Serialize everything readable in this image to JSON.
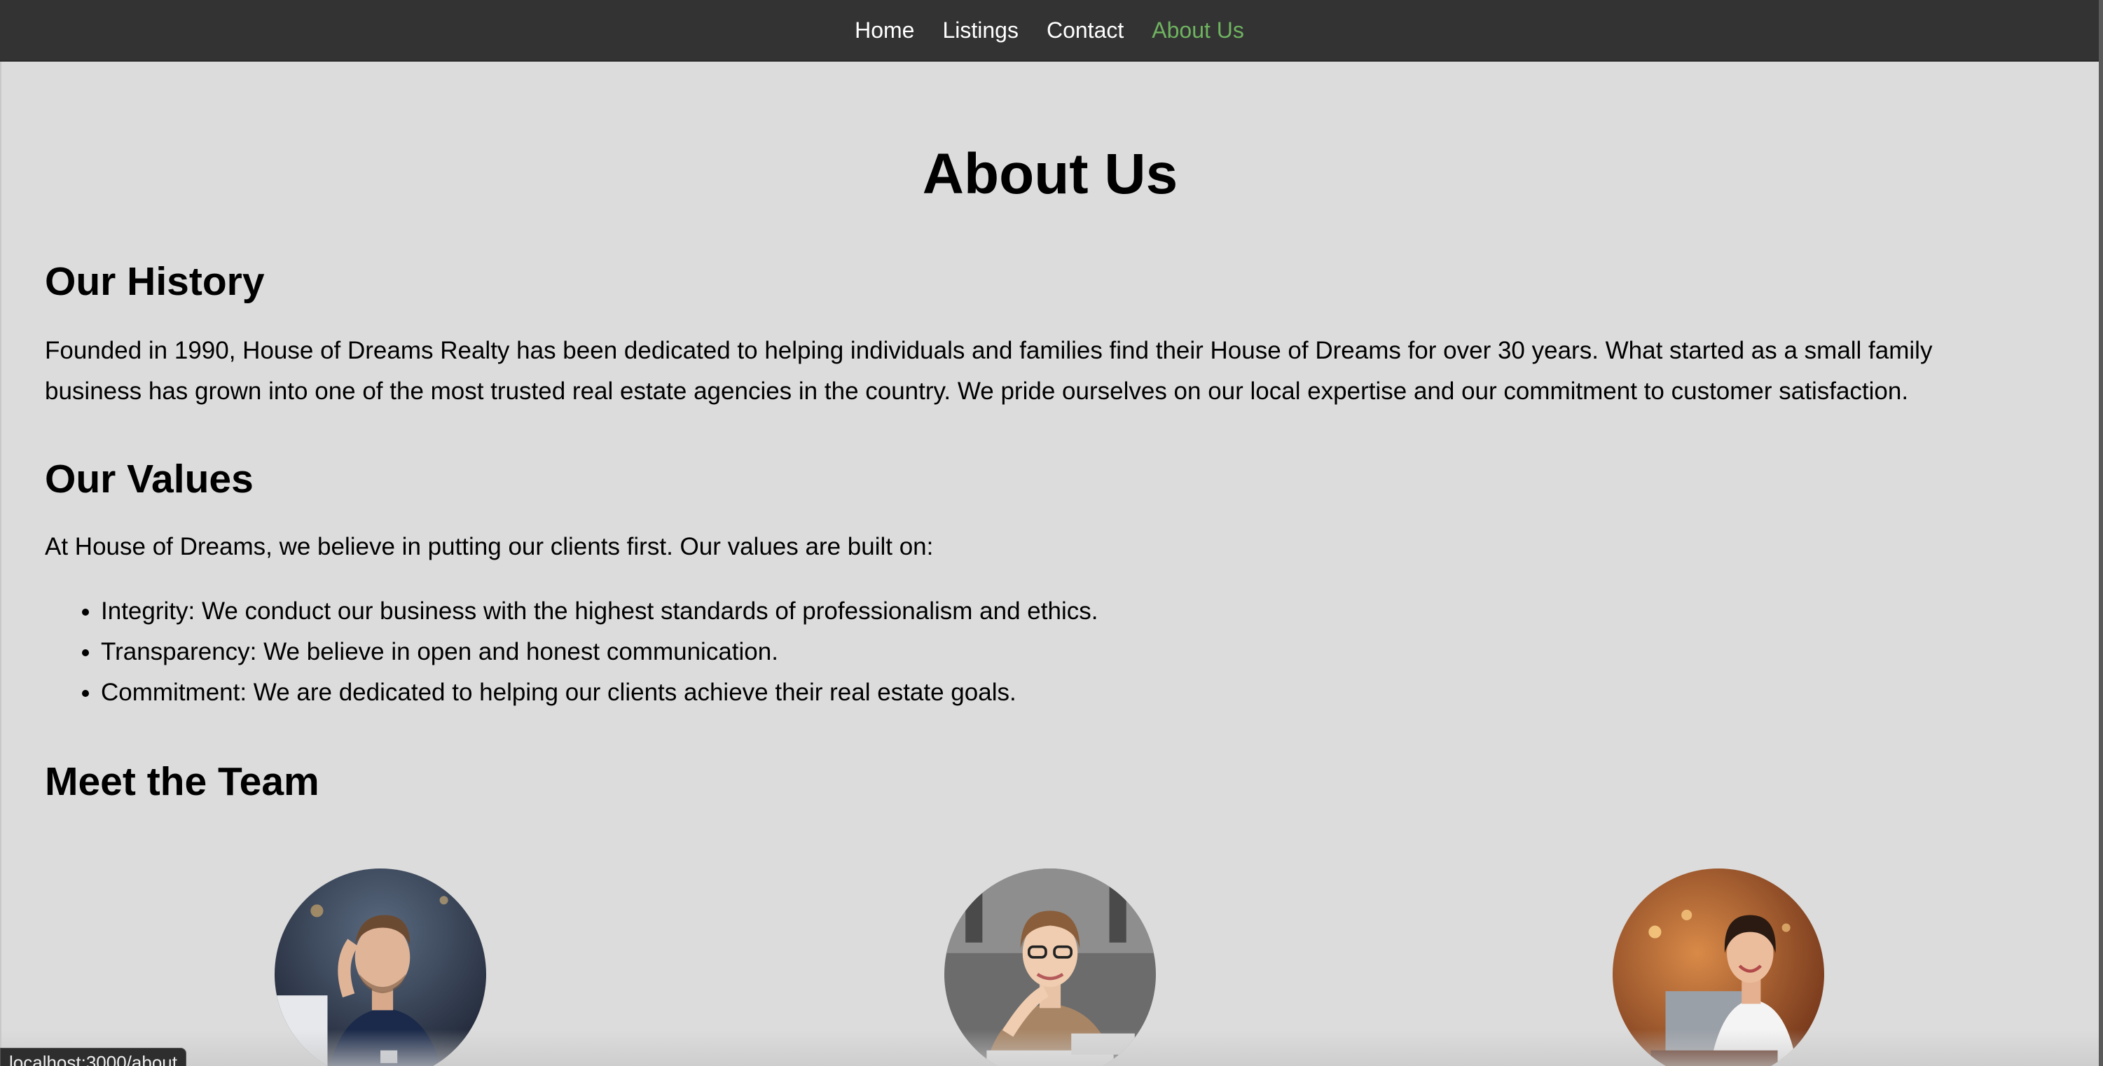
{
  "nav": {
    "items": [
      {
        "label": "Home",
        "active": false
      },
      {
        "label": "Listings",
        "active": false
      },
      {
        "label": "Contact",
        "active": false
      },
      {
        "label": "About Us",
        "active": true
      }
    ],
    "active_color": "#6fb360",
    "background": "#333333"
  },
  "page": {
    "title": "About Us"
  },
  "history": {
    "heading": "Our History",
    "text": "Founded in 1990, House of Dreams Realty has been dedicated to helping individuals and families find their House of Dreams for over 30 years. What started as a small family business has grown into one of the most trusted real estate agencies in the country. We pride ourselves on our local expertise and our commitment to customer satisfaction."
  },
  "values": {
    "heading": "Our Values",
    "intro": "At House of Dreams, we believe in putting our clients first. Our values are built on:",
    "items": [
      "Integrity: We conduct our business with the highest standards of professionalism and ethics.",
      "Transparency: We believe in open and honest communication.",
      "Commitment: We are dedicated to helping our clients achieve their real estate goals."
    ]
  },
  "team": {
    "heading": "Meet the Team",
    "members": [
      {
        "photo": "team-member-photo-1"
      },
      {
        "photo": "team-member-photo-2"
      },
      {
        "photo": "team-member-photo-3"
      }
    ]
  },
  "status_bar": {
    "url": "localhost:3000/about"
  }
}
